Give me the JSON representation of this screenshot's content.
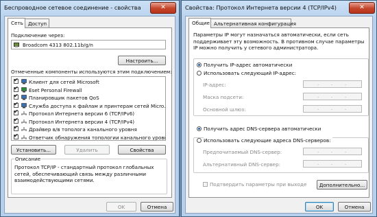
{
  "left_window": {
    "title": "Беспроводное сетевое соединение - свойства",
    "close_label": "✕",
    "tabs": [
      "Сеть",
      "Доступ"
    ],
    "connect_via_label": "Подключение через:",
    "adapter_name": "Broadcom 4313 802.11b/g/n",
    "configure_button": "Настроить...",
    "components_label": "Отмеченные компоненты используются этим подключением:",
    "components": [
      {
        "label": "Клиент для сетей Microsoft",
        "checked": true,
        "icon": "network-client-icon"
      },
      {
        "label": "Eset Personal Firewall",
        "checked": true,
        "icon": "firewall-icon"
      },
      {
        "label": "Планировщик пакетов QoS",
        "checked": true,
        "icon": "qos-icon"
      },
      {
        "label": "Служба доступа к файлам и принтерам сетей Micro...",
        "checked": true,
        "icon": "file-sharing-icon"
      },
      {
        "label": "Протокол Интернета версии 6 (TCP/IPv6)",
        "checked": true,
        "icon": "protocol-icon"
      },
      {
        "label": "Протокол Интернета версии 4 (TCP/IPv4)",
        "checked": true,
        "icon": "protocol-icon"
      },
      {
        "label": "Драйвер в/в тополога канального уровня",
        "checked": true,
        "icon": "protocol-icon"
      },
      {
        "label": "Ответчик обнаружения топологии канального уровня",
        "checked": true,
        "icon": "protocol-icon"
      }
    ],
    "install_button": "Установить...",
    "remove_button": "Удалить",
    "properties_button": "Свойства",
    "description_label": "Описание",
    "description_text": "Протокол TCP/IP - стандартный протокол глобальных сетей, обеспечивающий связь между различными взаимодействующими сетями.",
    "ok_button": "OK",
    "cancel_button": "Отмена"
  },
  "right_window": {
    "title": "Свойства: Протокол Интернета версии 4 (TCP/IPv4)",
    "close_label": "✕",
    "tabs": [
      "Общие",
      "Альтернативная конфигурация"
    ],
    "intro_text": "Параметры IP могут назначаться автоматически, если сеть поддерживает эту возможность. В противном случае параметры IP можно получить у сетевого администратора.",
    "radio_auto_ip": "Получить IP-адрес автоматически",
    "radio_manual_ip": "Использовать следующий IP-адрес:",
    "ip_label": "IP-адрес:",
    "mask_label": "Маска подсети:",
    "gateway_label": "Основной шлюз:",
    "radio_auto_dns": "Получить адрес DNS-сервера автоматически",
    "radio_manual_dns": "Использовать следующие адреса DNS-серверов:",
    "preferred_dns_label": "Предпочитаемый DNS-сервер:",
    "alternate_dns_label": "Альтернативный DNS-сервер:",
    "validate_checkbox": "Подтвердить параметры при выходе",
    "advanced_button": "Дополнительно...",
    "ok_button": "OK",
    "cancel_button": "Отмена"
  }
}
